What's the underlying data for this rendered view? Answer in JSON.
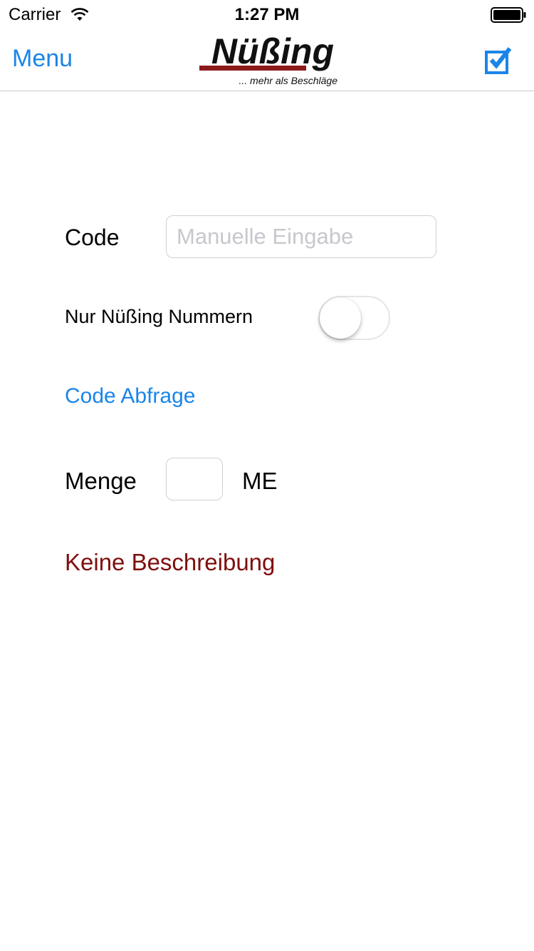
{
  "status_bar": {
    "carrier": "Carrier",
    "time": "1:27 PM",
    "wifi_icon": "wifi-icon",
    "battery_icon": "battery-icon"
  },
  "nav": {
    "menu_label": "Menu",
    "logo_name": "Nüßing",
    "logo_tagline": "... mehr als Beschläge",
    "confirm_icon": "checkbox-checked-icon"
  },
  "form": {
    "code_label": "Code",
    "code_value": "",
    "code_placeholder": "Manuelle Eingabe",
    "nur_nuessing_label": "Nur Nüßing Nummern",
    "nur_nuessing_on": false,
    "code_abfrage_label": "Code Abfrage",
    "menge_label": "Menge",
    "menge_value": "",
    "me_label": "ME",
    "description": "Keine Beschreibung"
  },
  "colors": {
    "accent": "#1a85e8",
    "description": "#7f0d0d",
    "logo_red": "#8b1a1a"
  }
}
